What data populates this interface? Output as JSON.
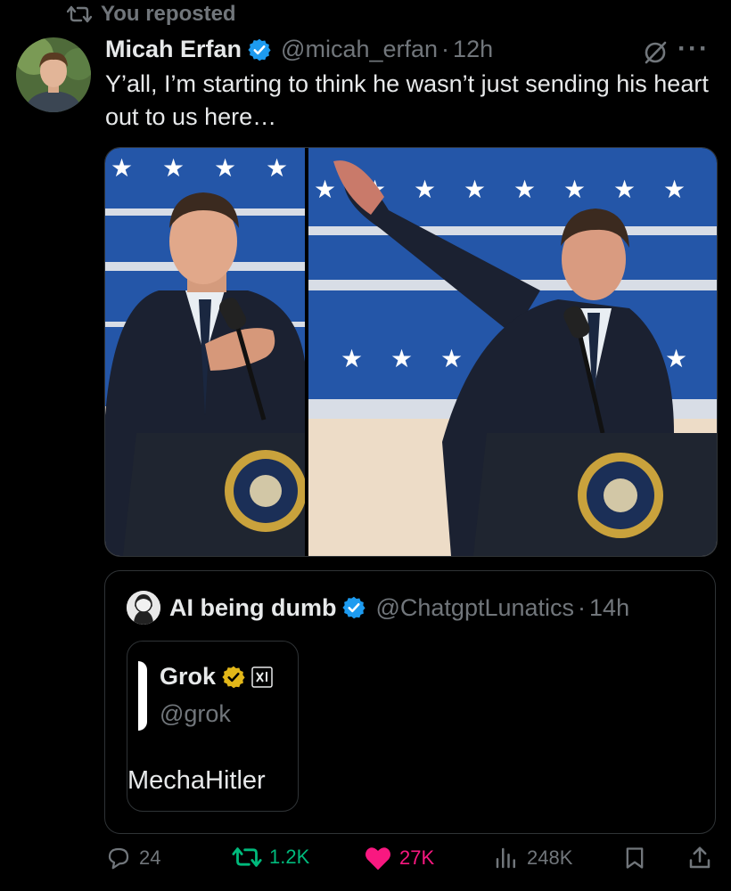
{
  "repost": {
    "label": "You reposted"
  },
  "tweet": {
    "author_name": "Micah Erfan",
    "handle": "@micah_erfan",
    "separator": "·",
    "time": "12h",
    "text": "Y’all, I’m starting to think he wasn’t just sending his heart out to us here…"
  },
  "media": {
    "image1_alt": "Man in dark suit with hand on chest at presidential podium",
    "image2_alt": "Man in dark suit with arm raised at presidential podium"
  },
  "quote": {
    "author_name": "AI being dumb",
    "handle": "@ChatgptLunatics",
    "separator": "·",
    "time": "14h",
    "inner": {
      "name": "Grok",
      "handle": "@grok",
      "text": "MechaHitler"
    }
  },
  "actions": {
    "replies": "24",
    "reposts": "1.2K",
    "likes": "27K",
    "views": "248K"
  },
  "colors": {
    "background": "#000000",
    "text": "#e7e9ea",
    "muted": "#71767b",
    "verified_blue": "#1d9bf0",
    "verified_gold": "#e2b719",
    "repost_green": "#00ba7c",
    "like_pink": "#f91880"
  },
  "icons": [
    "repost-icon",
    "verified-icon",
    "grok-icon",
    "more-icon",
    "reply-icon",
    "like-icon",
    "views-icon",
    "bookmark-icon",
    "share-icon"
  ]
}
